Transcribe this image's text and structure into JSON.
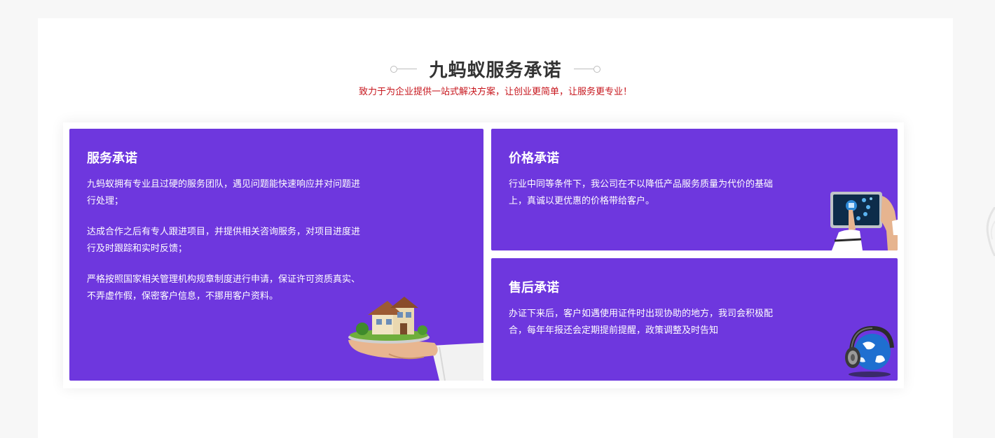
{
  "section": {
    "title": "九蚂蚁服务承诺",
    "subtitle": "致力于为企业提供一站式解决方案，让创业更简单，让服务更专业！"
  },
  "cards": {
    "service": {
      "title": "服务承诺",
      "paragraphs": [
        "九蚂蚁拥有专业且过硬的服务团队，遇见问题能快速响应并对问题进行处理；",
        "达成合作之后有专人跟进项目，并提供相关咨询服务，对项目进度进行及时跟踪和实时反馈；",
        "严格按照国家相关管理机构规章制度进行申请，保证许可资质真实、不弄虚作假，保密客户信息，不挪用客户资料。"
      ]
    },
    "price": {
      "title": "价格承诺",
      "paragraphs": [
        "行业中同等条件下，我公司在不以降低产品服务质量为代价的基础上，真诚以更优惠的价格带给客户。"
      ]
    },
    "after_sales": {
      "title": "售后承诺",
      "paragraphs": [
        "办证下来后，客户如遇使用证件时出现协助的地方，我司会积极配合，每年年报还会定期提前提醒，政策调整及时告知"
      ]
    }
  },
  "colors": {
    "card_bg": "#6e37de",
    "subtitle": "#c7161d",
    "title": "#333333"
  },
  "icons": {
    "service": "house-on-hand-icon",
    "price": "tablet-touch-icon",
    "after_sales": "headset-globe-icon"
  }
}
